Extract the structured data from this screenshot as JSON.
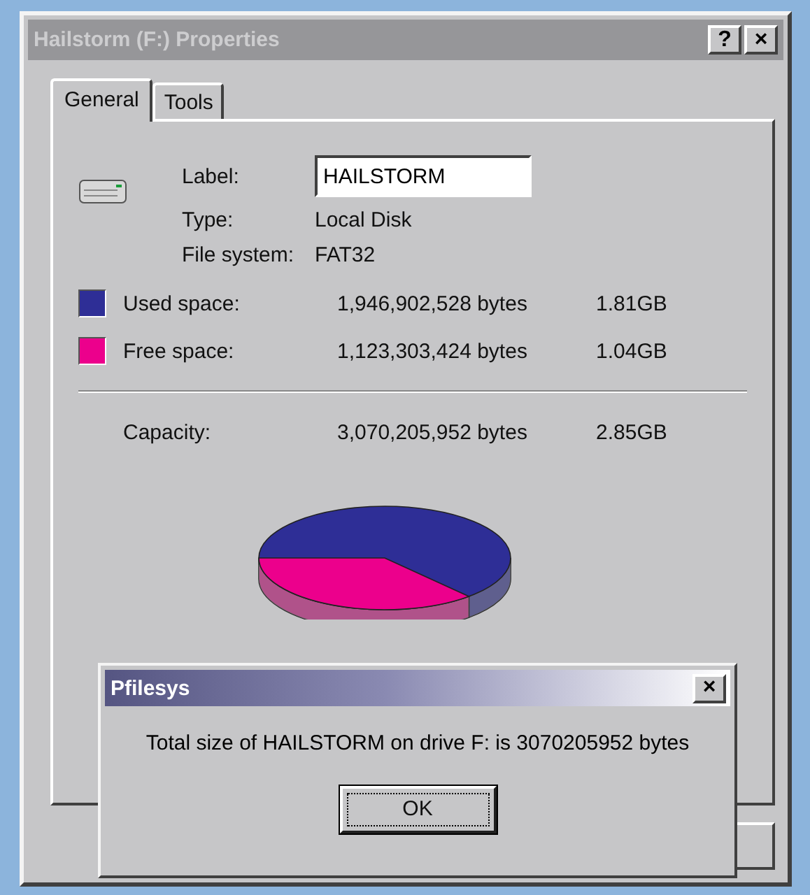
{
  "window": {
    "title": "Hailstorm (F:) Properties",
    "title_buttons": [
      "?",
      "×"
    ]
  },
  "tabs": [
    {
      "label": "General",
      "selected": true
    },
    {
      "label": "Tools",
      "selected": false
    }
  ],
  "drive": {
    "label_caption": "Label:",
    "label_value": "HAILSTORM",
    "info": [
      {
        "name": "Type:",
        "value": "Local Disk"
      },
      {
        "name": "File system:",
        "value": "FAT32"
      }
    ]
  },
  "space": [
    {
      "name": "Used space:",
      "bytes": "1,946,902,528 bytes",
      "size": "1.81GB",
      "color": "#2e2e96"
    },
    {
      "name": "Free space:",
      "bytes": "1,123,303,424 bytes",
      "size": "1.04GB",
      "color": "#ec008c"
    }
  ],
  "capacity": {
    "name": "Capacity:",
    "bytes": "3,070,205,952 bytes",
    "size": "2.85GB"
  },
  "dialog": {
    "title": "Pfilesys",
    "close": "×",
    "message": "Total size of HAILSTORM on drive F: is 3070205952 bytes",
    "buttons": [
      "OK"
    ]
  }
}
